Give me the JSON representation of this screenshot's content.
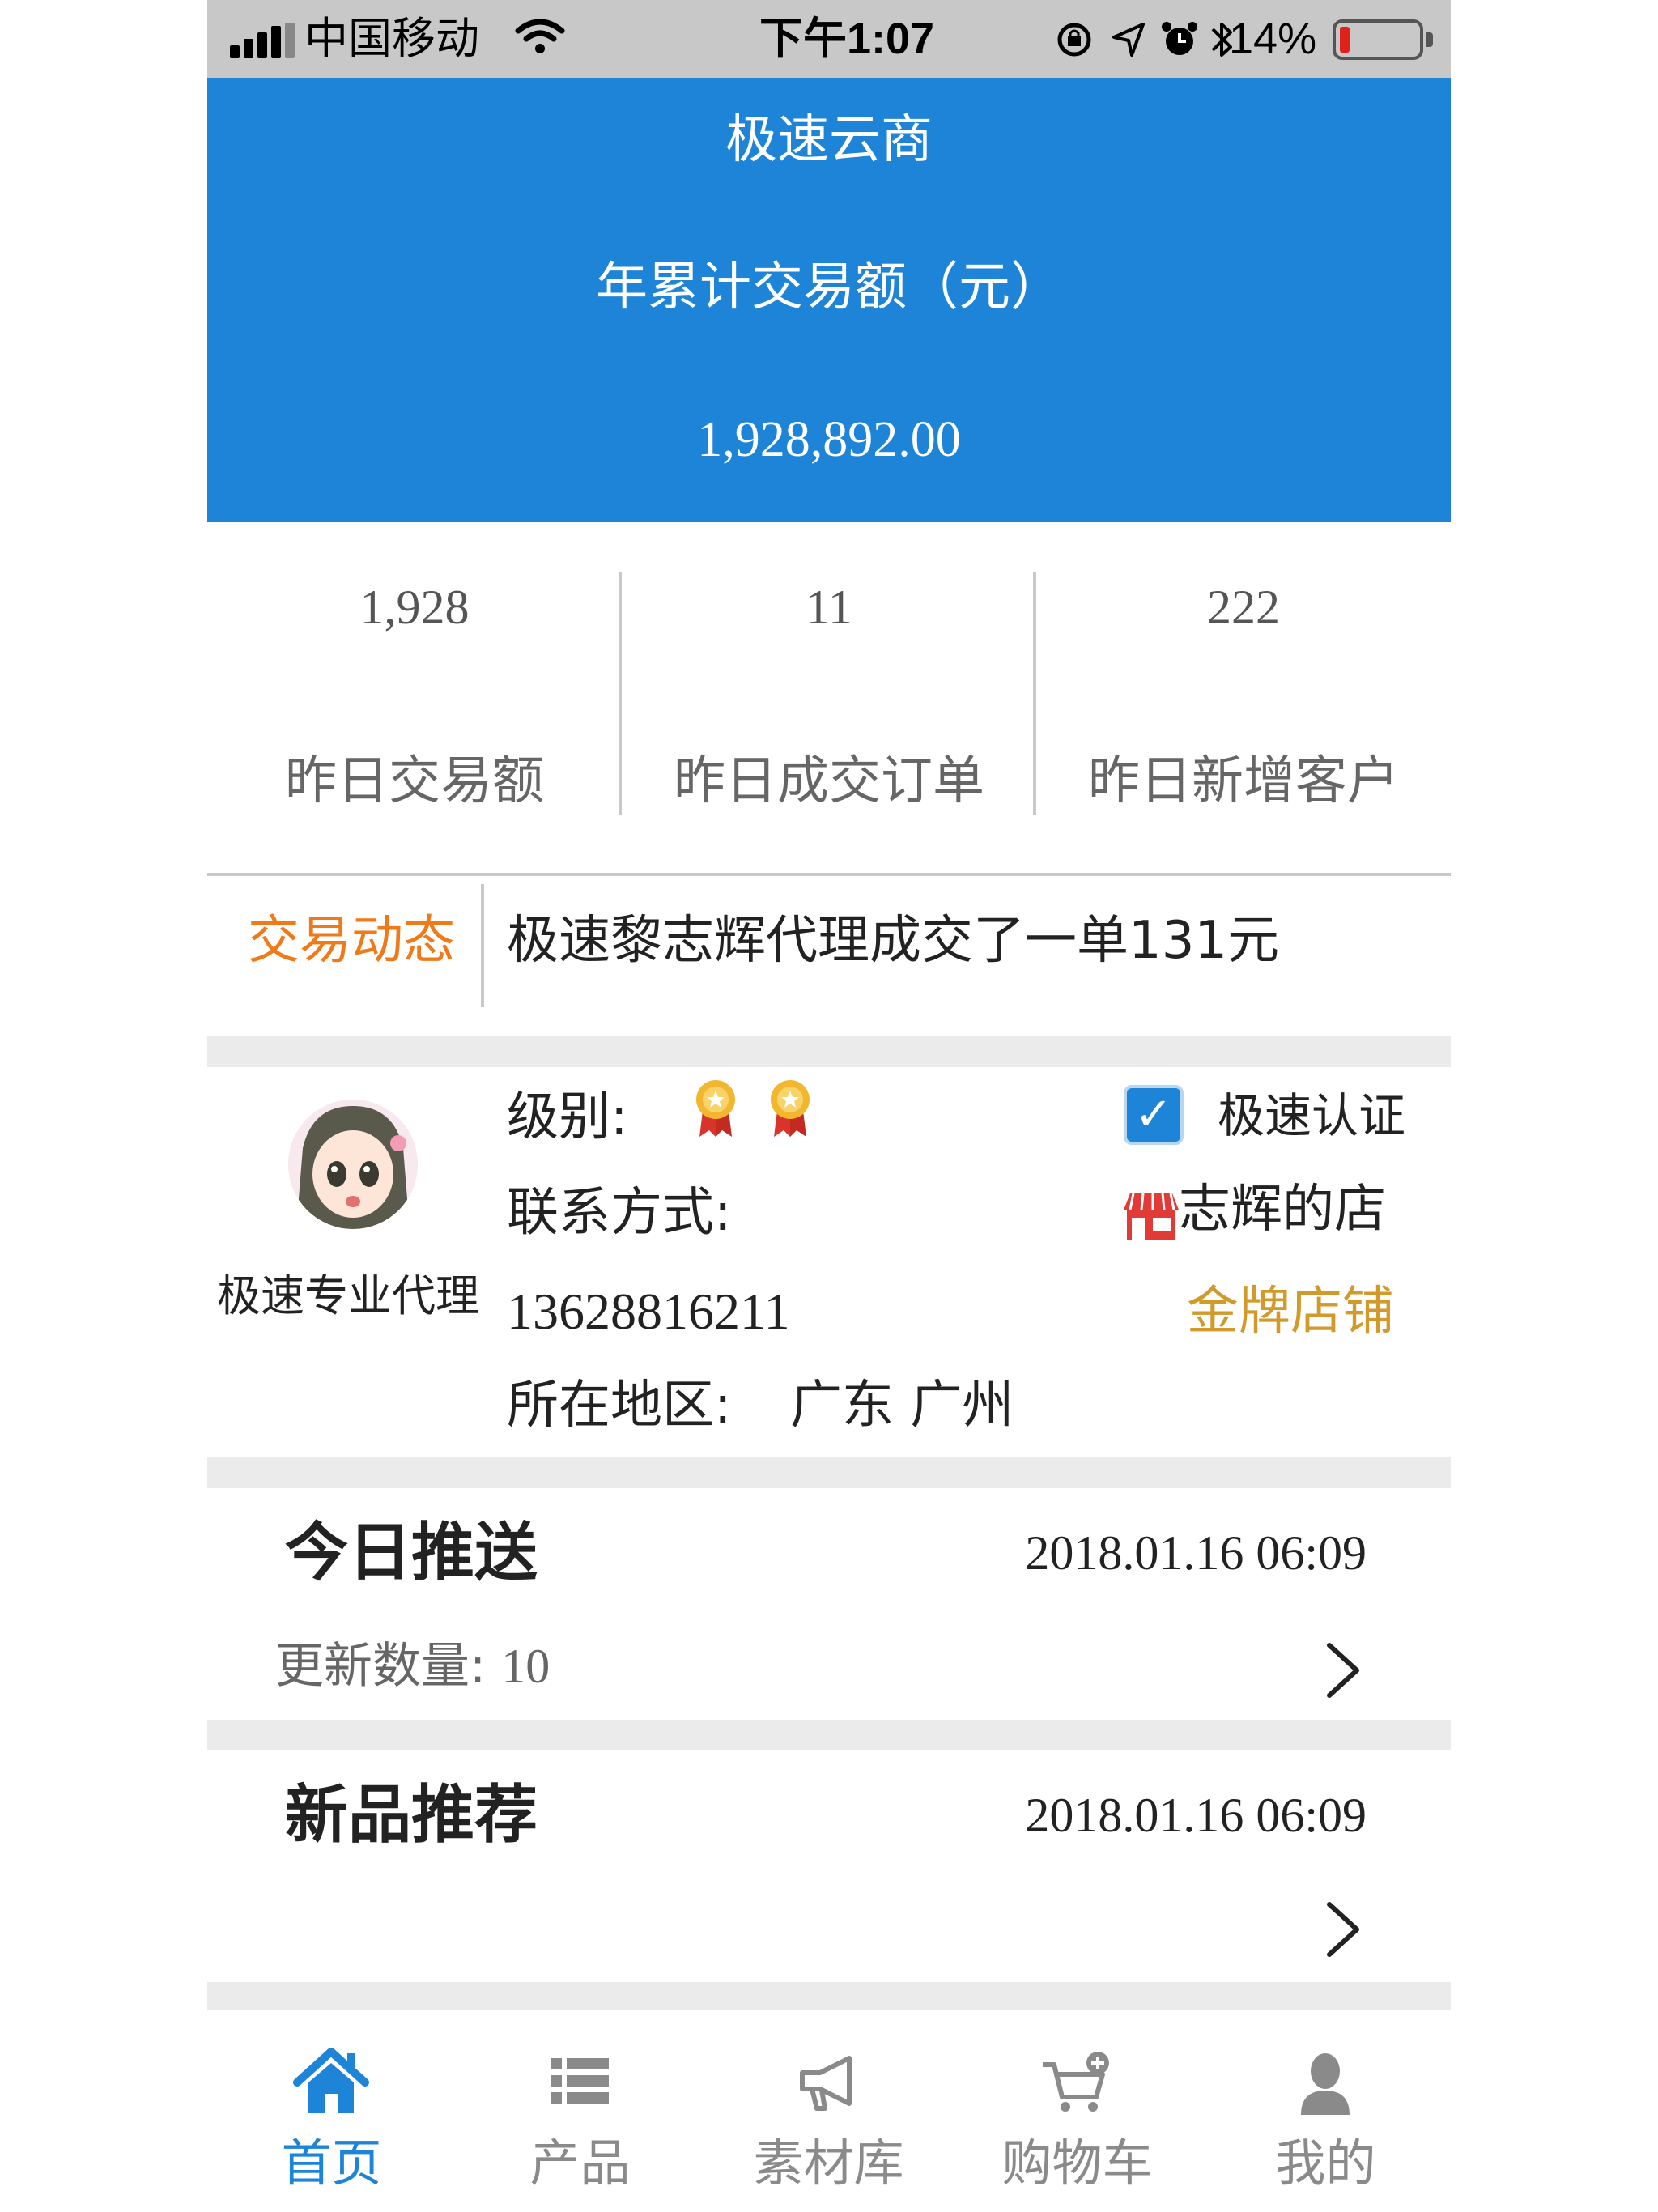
{
  "status_bar": {
    "carrier": "中国移动",
    "time": "下午1:07",
    "battery_percent": "14%",
    "battery_level": 0.14
  },
  "header": {
    "app_title": "极速云商",
    "annual_label": "年累计交易额（元）",
    "annual_value": "1,928,892.00"
  },
  "stats": [
    {
      "value": "1,928",
      "label": "昨日交易额"
    },
    {
      "value": "11",
      "label": "昨日成交订单"
    },
    {
      "value": "222",
      "label": "昨日新增客户"
    }
  ],
  "ticker": {
    "label": "交易动态",
    "text": "极速黎志辉代理成交了一单131元"
  },
  "profile": {
    "agent_title": "极速专业代理",
    "level_label": "级别:",
    "contact_label": "联系方式:",
    "phone": "13628816211",
    "region_label": "所在地区:",
    "region_value": "广东 广州",
    "certified": "极速认证",
    "shop_name": "志辉的店",
    "shop_tier": "金牌店铺"
  },
  "today_push": {
    "title": "今日推送",
    "time": "2018.01.16 06:09",
    "count_label": "更新数量:",
    "count_value": "10"
  },
  "new_products": {
    "title": "新品推荐",
    "time": "2018.01.16 06:09"
  },
  "tabs": [
    {
      "label": "首页",
      "icon": "home-icon",
      "active": true
    },
    {
      "label": "产品",
      "icon": "list-icon"
    },
    {
      "label": "素材库",
      "icon": "megaphone-icon"
    },
    {
      "label": "购物车",
      "icon": "cart-icon"
    },
    {
      "label": "我的",
      "icon": "user-icon"
    }
  ],
  "colors": {
    "primary": "#1e84d8",
    "accent_orange": "#f07a1a",
    "gold": "#d19a2a"
  }
}
